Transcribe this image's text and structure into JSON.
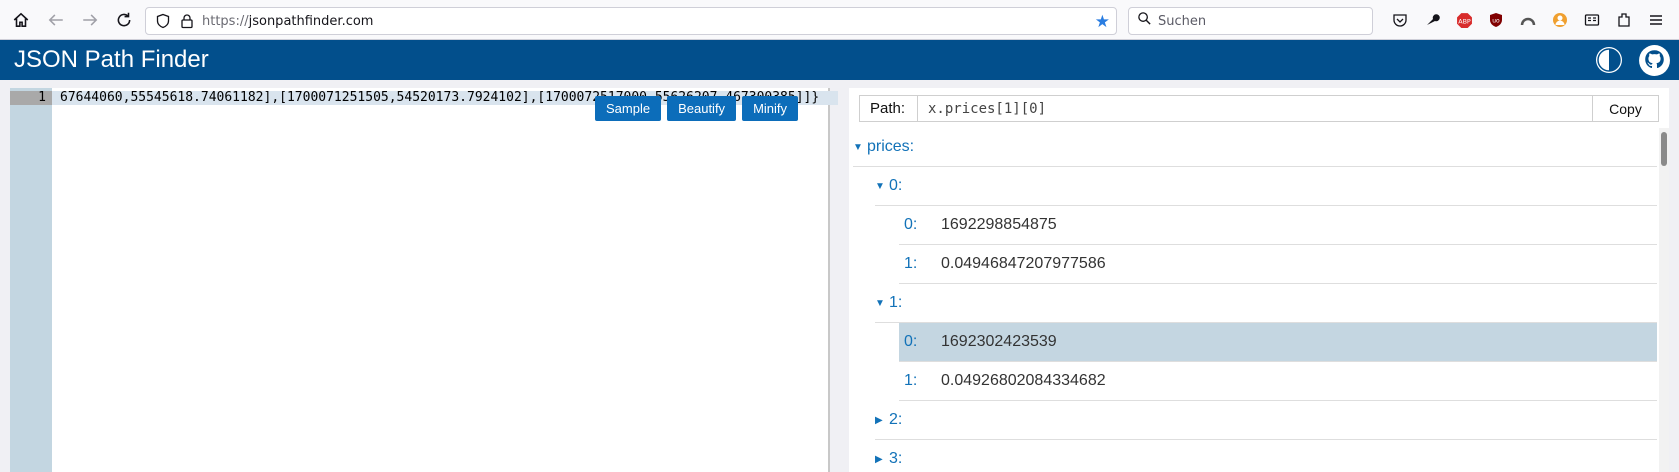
{
  "browser": {
    "url_scheme": "https://",
    "url_host": "jsonpathfinder.com",
    "search_placeholder": "Suchen",
    "extensions": [
      "pocket-icon",
      "wrench-icon",
      "adblock-plus-icon",
      "ublock-icon",
      "arc-icon",
      "multi-account-icon",
      "reader-icon",
      "extensions-icon",
      "menu-icon"
    ]
  },
  "app": {
    "title": "JSON Path Finder"
  },
  "editor": {
    "line_number": "1",
    "code_text": "67644060,55545618.74061182],[1700071251505,54520173.7924102],[1700072517000,55626207.467300385]]}",
    "buttons": {
      "sample": "Sample",
      "beautify": "Beautify",
      "minify": "Minify"
    }
  },
  "path_bar": {
    "label": "Path:",
    "value": "x.prices[1][0]",
    "copy_label": "Copy"
  },
  "tree": {
    "root_key": "prices:",
    "item0_key": "0:",
    "item0_child0_key": "0:",
    "item0_child0_value": "1692298854875",
    "item0_child1_key": "1:",
    "item0_child1_value": "0.04946847207977586",
    "item1_key": "1:",
    "item1_child0_key": "0:",
    "item1_child0_value": "1692302423539",
    "item1_child1_key": "1:",
    "item1_child1_value": "0.04926802084334682",
    "item2_key": "2:",
    "item3_key": "3:"
  }
}
